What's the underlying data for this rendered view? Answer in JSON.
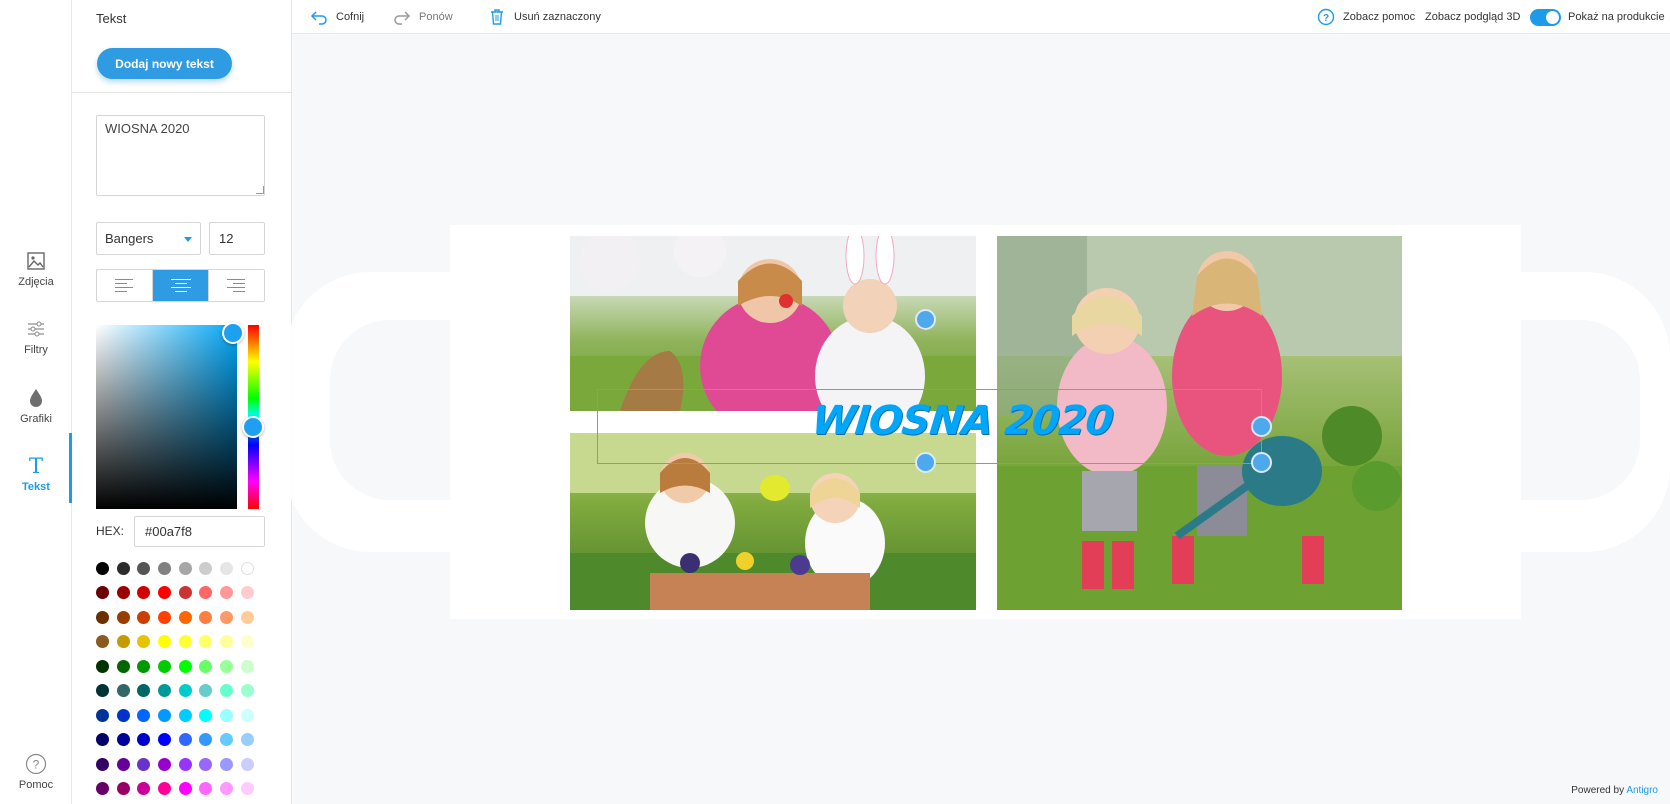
{
  "rail": {
    "items": [
      {
        "label": "Zdjęcia",
        "icon": "image-icon"
      },
      {
        "label": "Filtry",
        "icon": "sliders-icon"
      },
      {
        "label": "Grafiki",
        "icon": "drop-icon"
      },
      {
        "label": "Tekst",
        "icon": "text-icon"
      }
    ],
    "help": {
      "label": "Pomoc",
      "icon": "question-icon"
    }
  },
  "panel": {
    "title": "Tekst",
    "add_button": "Dodaj nowy tekst",
    "text_value": "WIOSNA 2020",
    "font_family": "Bangers",
    "font_size": "12",
    "alignment": "center",
    "hex_label": "HEX:",
    "hex_value": "#00a7f8",
    "swatch_rows": [
      [
        "#000000",
        "#2b2b2b",
        "#555555",
        "#808080",
        "#a6a6a6",
        "#cccccc",
        "#e5e5e5",
        "#ffffff"
      ],
      [
        "#6d0000",
        "#9a0000",
        "#d10000",
        "#ff0000",
        "#cc3333",
        "#ff6666",
        "#ff9999",
        "#ffcccc"
      ],
      [
        "#6b3000",
        "#9a3b00",
        "#cc3d00",
        "#ff4000",
        "#ff6600",
        "#ff8040",
        "#ff9966",
        "#ffcc99"
      ],
      [
        "#8a5a1e",
        "#c49a00",
        "#e6c300",
        "#ffff00",
        "#ffff33",
        "#ffff66",
        "#ffff99",
        "#ffffcc"
      ],
      [
        "#003300",
        "#006600",
        "#009900",
        "#00cc00",
        "#00ff00",
        "#66ff66",
        "#99ff99",
        "#ccffcc"
      ],
      [
        "#003333",
        "#336666",
        "#006666",
        "#009999",
        "#00cccc",
        "#66cccc",
        "#66ffcc",
        "#99ffcc"
      ],
      [
        "#003399",
        "#0033cc",
        "#0066ff",
        "#0099ff",
        "#00ccff",
        "#00ffff",
        "#99ffff",
        "#ccffff"
      ],
      [
        "#000066",
        "#000099",
        "#0000cc",
        "#0000ff",
        "#3366ff",
        "#3399ff",
        "#66ccff",
        "#99ccff"
      ],
      [
        "#330066",
        "#660099",
        "#6633cc",
        "#9900cc",
        "#9933ff",
        "#9966ff",
        "#9999ff",
        "#ccccff"
      ],
      [
        "#660066",
        "#990066",
        "#cc0099",
        "#ff0099",
        "#ff00ff",
        "#ff66ff",
        "#ff99ff",
        "#ffccff"
      ]
    ]
  },
  "toolbar": {
    "undo": "Cofnij",
    "redo": "Ponów",
    "delete": "Usuń zaznaczony",
    "help": "Zobacz pomoc",
    "preview3d": "Zobacz podgląd 3D",
    "show_production": "Pokaż na produkcie"
  },
  "canvas": {
    "design_text": "WIOSNA 2020",
    "text_color": "#00a7f8"
  },
  "footer": {
    "powered_prefix": "Powered by",
    "powered_link": "Antigro"
  },
  "colors": {
    "accent": "#2f9be3"
  }
}
